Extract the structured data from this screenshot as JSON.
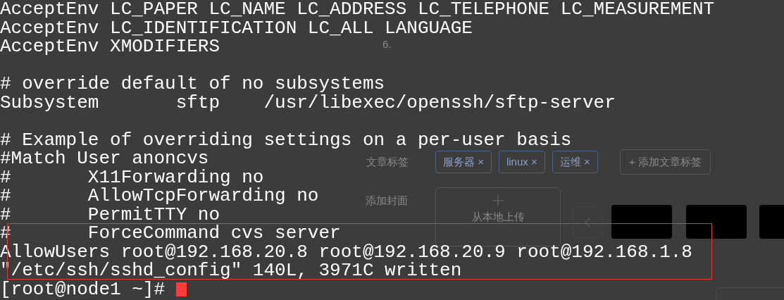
{
  "terminal": {
    "blocks": [
      {
        "lines": [
          "AcceptEnv LC_PAPER LC_NAME LC_ADDRESS LC_TELEPHONE LC_MEASUREMENT",
          "AcceptEnv LC_IDENTIFICATION LC_ALL LANGUAGE",
          "AcceptEnv XMODIFIERS"
        ]
      },
      {
        "lines": [
          "# override default of no subsystems",
          "Subsystem       sftp    /usr/libexec/openssh/sftp-server"
        ]
      },
      {
        "lines": [
          "# Example of overriding settings on a per-user basis",
          "#Match User anoncvs",
          "#       X11Forwarding no",
          "#       AllowTcpForwarding no",
          "#       PermitTTY no",
          "#       ForceCommand cvs server",
          "AllowUsers root@192.168.20.8 root@192.168.20.9 root@192.168.1.8",
          "\"/etc/ssh/sshd_config\" 140L, 3971C written"
        ]
      }
    ],
    "prompt": "[root@node1 ~]# "
  },
  "background_page": {
    "step_number": "6.",
    "tags_label": "文章标签",
    "tags": [
      {
        "label": "服务器",
        "remove": "×"
      },
      {
        "label": "linux",
        "remove": "×"
      },
      {
        "label": "运维",
        "remove": "×"
      }
    ],
    "add_tag_sign": "+",
    "add_tag_button": "添加文章标签",
    "cover_label": "添加封面",
    "upload_label": "从本地上传"
  }
}
